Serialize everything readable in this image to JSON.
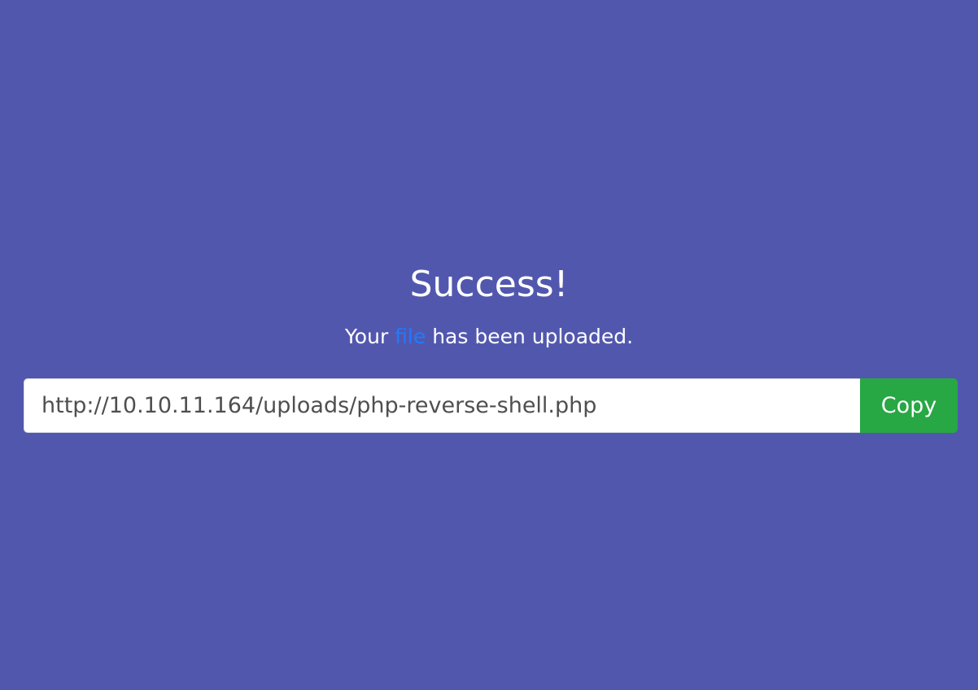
{
  "page": {
    "background_color": "#5257ae"
  },
  "success": {
    "title": "Success!",
    "message_prefix": "Your ",
    "message_link": "file",
    "message_suffix": " has been uploaded."
  },
  "upload": {
    "url": "http://10.10.11.164/uploads/php-reverse-shell.php",
    "copy_label": "Copy"
  },
  "colors": {
    "link": "#1e7bff",
    "copy_button": "#28a745",
    "input_text": "#4f4f4f"
  }
}
